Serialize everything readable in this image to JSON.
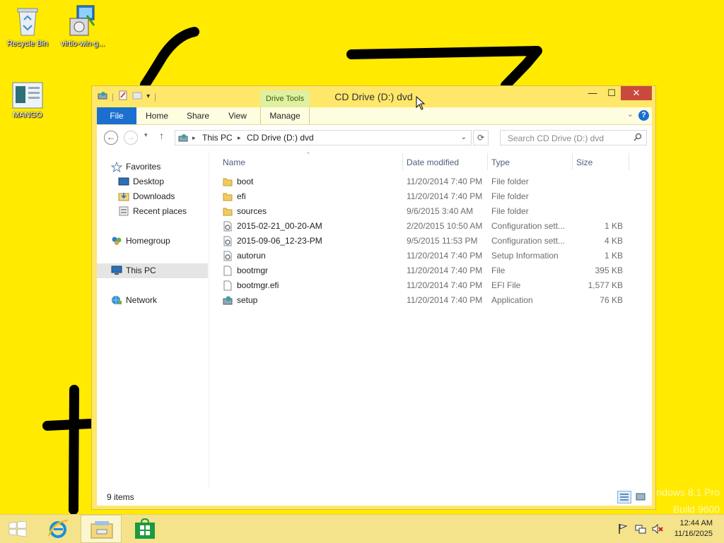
{
  "desktop": {
    "icons": [
      {
        "label": "Recycle Bin"
      },
      {
        "label": "virtio-win-g..."
      },
      {
        "label": "MANGO"
      }
    ],
    "watermark": {
      "line1": "indows 8.1 Pro",
      "line2": "Build 9600"
    }
  },
  "window": {
    "title": "CD Drive (D:) dvd",
    "contextual_tab_group": "Drive Tools",
    "controls": {
      "minimize": "—",
      "maximize": "☐",
      "close": "✕"
    },
    "ribbon_tabs": {
      "file": "File",
      "home": "Home",
      "share": "Share",
      "view": "View",
      "manage": "Manage"
    },
    "help": "?"
  },
  "address_bar": {
    "crumbs": [
      "This PC",
      "CD Drive (D:) dvd"
    ],
    "search_placeholder": "Search CD Drive (D:) dvd"
  },
  "navigation_pane": {
    "favorites": "Favorites",
    "favorites_items": [
      "Desktop",
      "Downloads",
      "Recent places"
    ],
    "homegroup": "Homegroup",
    "this_pc": "This PC",
    "network": "Network",
    "selected": "This PC"
  },
  "file_list": {
    "columns": {
      "name": "Name",
      "date": "Date modified",
      "type": "Type",
      "size": "Size"
    },
    "rows": [
      {
        "name": "boot",
        "date": "11/20/2014 7:40 PM",
        "type": "File folder",
        "size": "",
        "icon": "folder-icon"
      },
      {
        "name": "efi",
        "date": "11/20/2014 7:40 PM",
        "type": "File folder",
        "size": "",
        "icon": "folder-icon"
      },
      {
        "name": "sources",
        "date": "9/6/2015 3:40 AM",
        "type": "File folder",
        "size": "",
        "icon": "folder-icon"
      },
      {
        "name": "2015-02-21_00-20-AM",
        "date": "2/20/2015 10:50 AM",
        "type": "Configuration sett...",
        "size": "1 KB",
        "icon": "config-file-icon"
      },
      {
        "name": "2015-09-06_12-23-PM",
        "date": "9/5/2015 11:53 PM",
        "type": "Configuration sett...",
        "size": "4 KB",
        "icon": "config-file-icon"
      },
      {
        "name": "autorun",
        "date": "11/20/2014 7:40 PM",
        "type": "Setup Information",
        "size": "1 KB",
        "icon": "config-file-icon"
      },
      {
        "name": "bootmgr",
        "date": "11/20/2014 7:40 PM",
        "type": "File",
        "size": "395 KB",
        "icon": "blank-file-icon"
      },
      {
        "name": "bootmgr.efi",
        "date": "11/20/2014 7:40 PM",
        "type": "EFI File",
        "size": "1,577 KB",
        "icon": "blank-file-icon"
      },
      {
        "name": "setup",
        "date": "11/20/2014 7:40 PM",
        "type": "Application",
        "size": "76 KB",
        "icon": "setup-app-icon"
      }
    ]
  },
  "status_bar": {
    "item_count": "9 items"
  },
  "taskbar": {
    "clock_time": "12:44 AM",
    "clock_date": "11/16/2025"
  },
  "colors": {
    "desktop_background": "#ffea00",
    "window_frame": "#ffe76a",
    "file_tab": "#1a6fd0",
    "close_button": "#c94a3d",
    "selection": "#e5e5e5"
  }
}
